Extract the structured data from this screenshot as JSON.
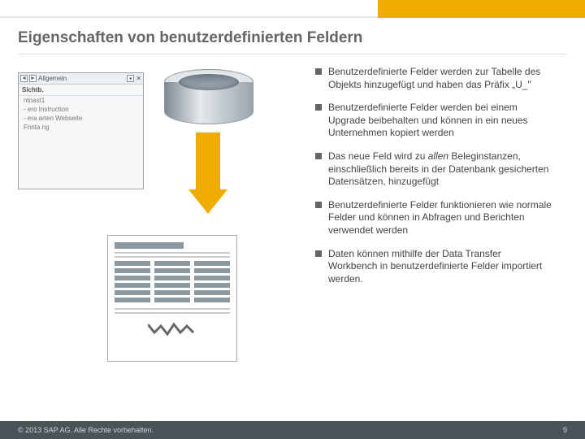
{
  "title": "Eigenschaften von benutzerdefinierten Feldern",
  "panel": {
    "tab": "Allgemein",
    "section": "Sichtb.",
    "rows": [
      "ntoast1",
      "- ero Instruction",
      "- era arten Webseite",
      "Fnnta ng"
    ]
  },
  "bullets": [
    "Benutzerdefinierte Felder werden zur Tabelle des Objekts hinzugefügt und haben das Präfix „U_\"",
    "Benutzerdefinierte Felder werden bei einem Upgrade beibehalten und können in ein neues Unternehmen kopiert werden",
    "Das neue Feld wird zu <i>allen</i> Beleginstanzen, einschließlich bereits in der Datenbank gesicherten Datensätzen, hinzugefügt",
    "Benutzerdefinierte Felder funktionieren wie normale Felder und können in Abfragen und Berichten verwendet werden",
    "Daten können mithilfe der Data Transfer Workbench in benutzerdefinierte Felder importiert werden."
  ],
  "footer": {
    "copyright": "© 2013 SAP AG. Alle Rechte vorbehalten.",
    "page": "9"
  }
}
